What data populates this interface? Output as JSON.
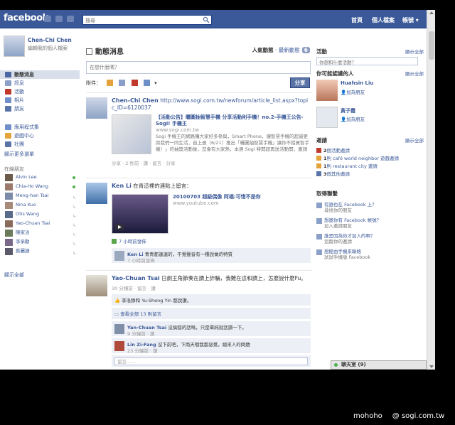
{
  "topbar": {
    "logo": "facebook",
    "search_placeholder": "搜尋",
    "nav": [
      "首頁",
      "個人檔案",
      "帳號"
    ]
  },
  "profile": {
    "name": "Chen-Chi Chen",
    "edit": "編輯我的個人檔案"
  },
  "left_nav": [
    {
      "label": "動態消息",
      "active": true,
      "icon": "news-feed-icon",
      "color": "#4b67a1"
    },
    {
      "label": "訊息",
      "active": false,
      "icon": "messages-icon",
      "color": "#8aa0c8"
    },
    {
      "label": "活動",
      "active": false,
      "icon": "events-icon",
      "color": "#c0392b"
    },
    {
      "label": "相片",
      "active": false,
      "icon": "photos-icon",
      "color": "#6e8fc7"
    },
    {
      "label": "朋友",
      "active": false,
      "icon": "friends-icon",
      "color": "#5b74a8"
    }
  ],
  "left_apps": [
    {
      "label": "應用程式集",
      "icon": "apps-icon",
      "color": "#6e8fc7"
    },
    {
      "label": "遊戲中心",
      "icon": "games-icon",
      "color": "#e4a33b"
    },
    {
      "label": "社團",
      "icon": "groups-icon",
      "color": "#5b74a8"
    }
  ],
  "left_more": "顯示更多選單",
  "friends_header": "在線朋友",
  "friends": [
    {
      "name": "Alvin Lee",
      "status": "online"
    },
    {
      "name": "Chia-Ho Wang",
      "status": "online"
    },
    {
      "name": "Meng-han Tsai",
      "status": "mobile"
    },
    {
      "name": "Nina Kuo",
      "status": "mobile"
    },
    {
      "name": "Otis Wang",
      "status": "mobile"
    },
    {
      "name": "Yao-Chuan Tsai",
      "status": "mobile"
    },
    {
      "name": "陳家洽",
      "status": "mobile"
    },
    {
      "name": "李承勳",
      "status": "mobile"
    },
    {
      "name": "蔡麗捷",
      "status": "mobile"
    }
  ],
  "friends_more": "顯示全部",
  "feed": {
    "title": "動態消息",
    "sort_label": "人氣動態",
    "sort_latest": "最新動態",
    "count": "6",
    "status_placeholder": "在想什麼嗎？",
    "attach_label": "附件：",
    "share_button": "分享"
  },
  "posts": [
    {
      "author": "Chen-Chi Chen",
      "text": "http://www.sogi.com.tw/newforum/article_list.aspx?topic_ID=6120037",
      "link_title": "【活動公告】曬圖抽智慧手機 分享活動則手機！no.2-手機王公告-Sogi! 手機王",
      "link_domain": "www.sogi.com.tw",
      "link_desc": "Sogi 手機王的網路購大家好多參與，Smart Phone，讓智慧手機的超過更將我們一同生活，自上週（6/21）推出「曬圖抽智慧手機」讓你不錯買智手機！」的抽獎活動後，您會有大家熱，本週 Sogi 特開超再送活動開，邀請加碼活動的快…",
      "meta": "分享 · 2 秒前 · 讚 · 留言 · 分享"
    },
    {
      "author": "Ken Li",
      "action": "在青這裡的連貼上留言：",
      "link_title": "20100703 超級偶像 阿福:可惜不是你",
      "link_domain": "www.youtube.com",
      "meta": "7 小時前發佈",
      "comment_author": "Ken Li",
      "comment_text": "青青都連連的，不覺聲音有一種說做的特質",
      "comment_time": "7 小時前發佈"
    },
    {
      "author": "Yao-Chuan Tsai",
      "text": "日劇王角節奏在讀上詐騙，我難在這和讀上，怎麼說什麼Fu。",
      "meta": "30 分鐘前 · 留言 · 讚",
      "likes": "李洛錚和 Yu-Sheng Yin 都說讚。",
      "all_comments": "查看全部 13 則留言",
      "comments": [
        {
          "author": "Yan-Chuan Tsai",
          "text": "沒搞錯的話嗎，只是單純就話讀一下。",
          "time": "9 分鐘前 · 讚"
        },
        {
          "author": "Lin Zi-Fang",
          "text": "沒下前吧，下雨天咽我都惡覺，總來人的問題",
          "time": "23 分鐘前 · 讚"
        }
      ],
      "comment_placeholder": "留言……"
    }
  ],
  "right": {
    "activity_header": "活動",
    "show_all": "顯示全部",
    "activity_search": "你想和什麼活動？",
    "pymk_header": "你可能認識的人",
    "people": [
      {
        "name": "Huahsin Liu",
        "action": "加為朋友"
      },
      {
        "name": "黃子霞",
        "action": "加為朋友"
      }
    ],
    "requests_header": "邀請",
    "requests": [
      {
        "count": "2",
        "text": "個活動邀請",
        "icon": "event-invite-icon",
        "color": "#c0392b"
      },
      {
        "count": "1",
        "text": "則 café world neighbor 遊戲邀請",
        "icon": "game-invite-icon",
        "color": "#e4a33b"
      },
      {
        "count": "1",
        "text": "則 restaurant city 邀請",
        "icon": "app-invite-icon",
        "color": "#e4a33b"
      },
      {
        "count": "3",
        "text": "個其他邀請",
        "icon": "other-invite-icon",
        "color": "#5b74a8"
      }
    ],
    "connect_header": "取得聯繫",
    "connect": [
      {
        "title": "有誰也在 Facebook 上？",
        "sub": "尋找你的朋友"
      },
      {
        "title": "想邀你有 Facebook 帳號？",
        "sub": "加入邀請朋友"
      },
      {
        "title": "誰是因為你才加入的啊？",
        "sub": "追蹤你的邀請"
      },
      {
        "title": "想經由手機來聯絡",
        "sub": "試試手機版 Facebook"
      }
    ],
    "chat": "聊天室 (9)"
  },
  "watermark": {
    "left": "mohoho",
    "right": "@ sogi.com.tw"
  }
}
